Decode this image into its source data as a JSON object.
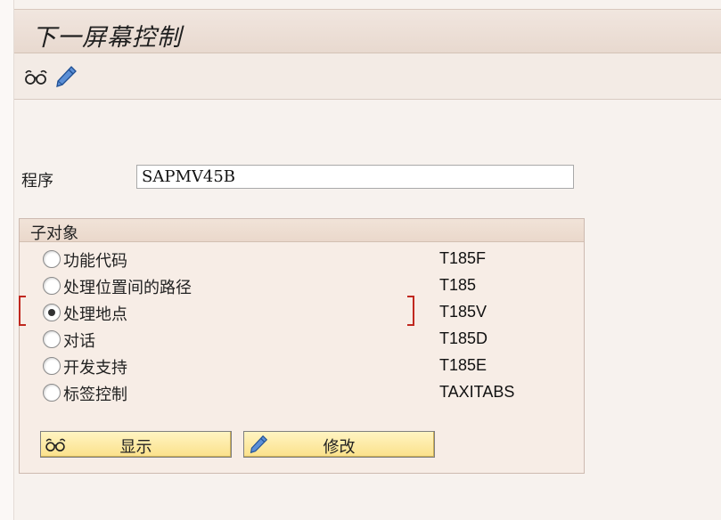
{
  "window": {
    "title": "下一屏幕控制"
  },
  "toolbar": {
    "display_icon": "glasses-icon",
    "change_icon": "pencil-icon"
  },
  "program": {
    "label": "程序",
    "value": "SAPMV45B"
  },
  "subobjects": {
    "title": "子对象",
    "selected_index": 2,
    "options": [
      {
        "label": "功能代码",
        "code": "T185F"
      },
      {
        "label": "处理位置间的路径",
        "code": "T185"
      },
      {
        "label": "处理地点",
        "code": "T185V"
      },
      {
        "label": "对话",
        "code": "T185D"
      },
      {
        "label": "开发支持",
        "code": "T185E"
      },
      {
        "label": "标签控制",
        "code": "TAXITABS"
      }
    ]
  },
  "buttons": {
    "display_label": "显示",
    "change_label": "修改"
  },
  "colors": {
    "background": "#f7f2ee",
    "button_fill": "#fbe18a",
    "focus_bracket": "#c0281f"
  }
}
